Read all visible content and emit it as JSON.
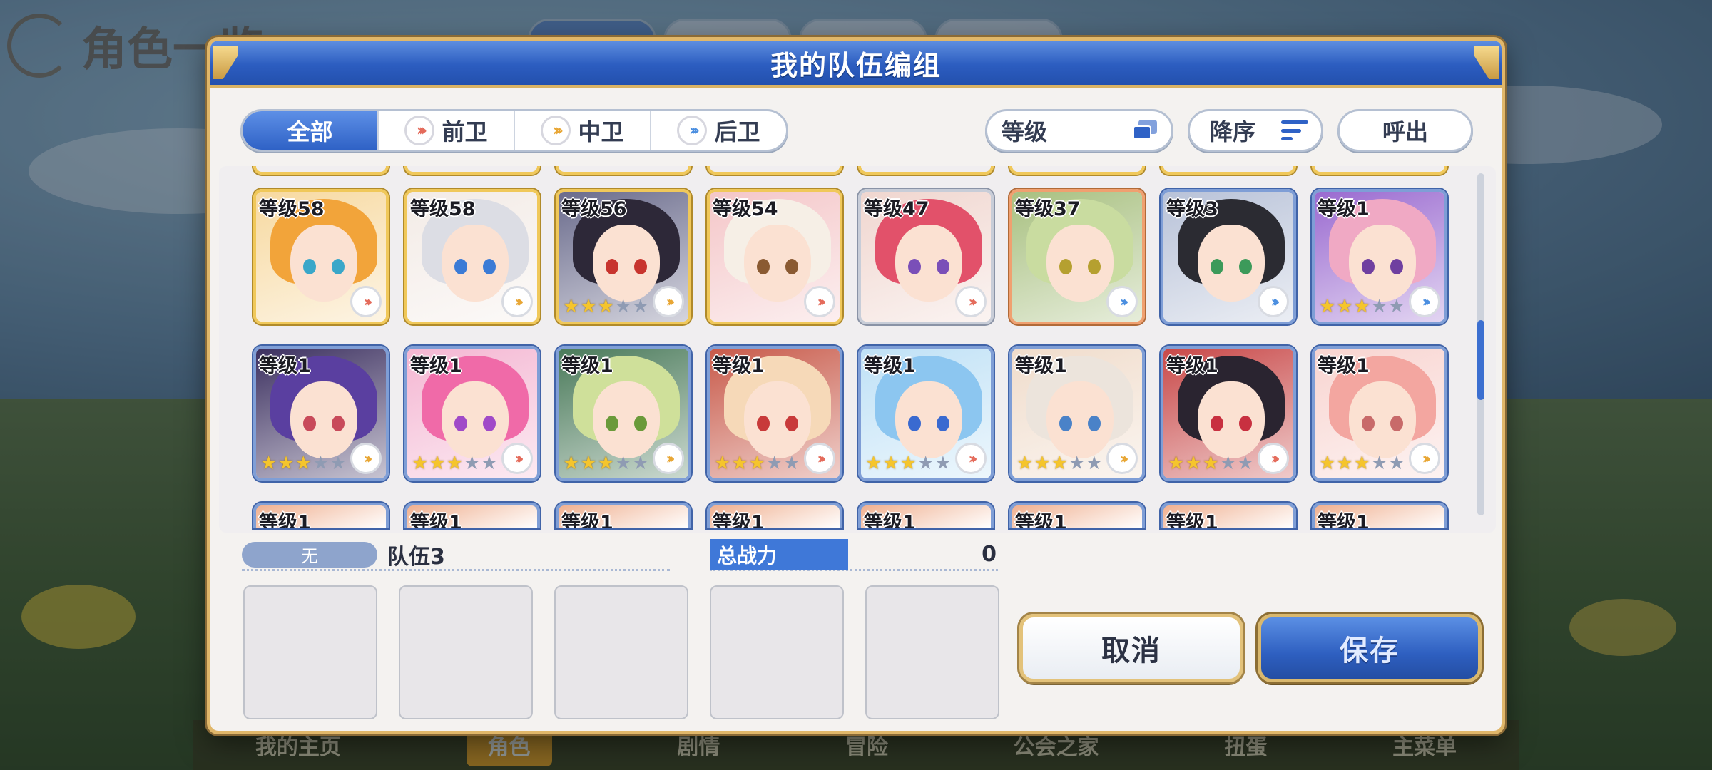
{
  "background": {
    "page_title": "角色一览",
    "nav": [
      "我的主页",
      "角色",
      "剧情",
      "冒险",
      "公会之家",
      "扭蛋",
      "主菜单"
    ]
  },
  "modal": {
    "title": "我的队伍编组",
    "filter_tabs": [
      {
        "label": "全部",
        "icon": "none",
        "active": true
      },
      {
        "label": "前卫",
        "icon": "front-role-icon",
        "active": false
      },
      {
        "label": "中卫",
        "icon": "mid-role-icon",
        "active": false
      },
      {
        "label": "后卫",
        "icon": "back-role-icon",
        "active": false
      }
    ],
    "sort_label": "等级",
    "order_label": "降序",
    "call_label": "呼出",
    "roster": {
      "row1": [
        {
          "level": "等级58",
          "frame": "gold",
          "stars": 0,
          "role": "front",
          "hair": "#f2a43a",
          "eye": "#3aa7c9",
          "bg": "#f7d9a0"
        },
        {
          "level": "等级58",
          "frame": "gold",
          "stars": 0,
          "role": "mid",
          "hair": "#dcdde4",
          "eye": "#3b7bd6",
          "bg": "#f3ebe6"
        },
        {
          "level": "等级56",
          "frame": "gold",
          "stars": 3,
          "role": "mid",
          "hair": "#2d2838",
          "eye": "#c8342e",
          "bg": "#6a6b8c"
        },
        {
          "level": "等级54",
          "frame": "gold",
          "stars": 0,
          "role": "front",
          "hair": "#f6efe6",
          "eye": "#8a5a32",
          "bg": "#f4c6c8"
        },
        {
          "level": "等级47",
          "frame": "silver",
          "stars": 0,
          "role": "front",
          "hair": "#e2516a",
          "eye": "#7a4fb8",
          "bg": "#f0d6cf"
        },
        {
          "level": "等级37",
          "frame": "copper",
          "stars": 0,
          "role": "back",
          "hair": "#c9dca0",
          "eye": "#b5a030",
          "bg": "#a8c080"
        },
        {
          "level": "等级3",
          "frame": "blue",
          "stars": 0,
          "role": "back",
          "hair": "#2b2b32",
          "eye": "#3c9a5a",
          "bg": "#b8c2d8"
        },
        {
          "level": "等级1",
          "frame": "blue",
          "stars": 3,
          "role": "back",
          "hair": "#f0a9c4",
          "eye": "#6f3fa0",
          "bg": "#9a6ad0"
        }
      ],
      "row2": [
        {
          "level": "等级1",
          "frame": "blue",
          "stars": 3,
          "role": "mid",
          "hair": "#5a3fa0",
          "eye": "#c84a5a",
          "bg": "#3c3060"
        },
        {
          "level": "等级1",
          "frame": "blue",
          "stars": 3,
          "role": "front",
          "hair": "#f06aa8",
          "eye": "#a04ac8",
          "bg": "#f4b6d2"
        },
        {
          "level": "等级1",
          "frame": "blue",
          "stars": 3,
          "role": "mid",
          "hair": "#cfe09a",
          "eye": "#6a9a3a",
          "bg": "#4a7a5a"
        },
        {
          "level": "等级1",
          "frame": "blue",
          "stars": 3,
          "role": "front",
          "hair": "#f6d9b8",
          "eye": "#c83a3a",
          "bg": "#c85a4a"
        },
        {
          "level": "等级1",
          "frame": "blue",
          "stars": 3,
          "role": "front",
          "hair": "#8cc6f0",
          "eye": "#3a6ad0",
          "bg": "#bfe1f6"
        },
        {
          "level": "等级1",
          "frame": "blue",
          "stars": 3,
          "role": "mid",
          "hair": "#ece4dc",
          "eye": "#4a82c8",
          "bg": "#f0dccb"
        },
        {
          "level": "等级1",
          "frame": "blue",
          "stars": 3,
          "role": "front",
          "hair": "#2a2430",
          "eye": "#c83040",
          "bg": "#c84848"
        },
        {
          "level": "等级1",
          "frame": "blue",
          "stars": 3,
          "role": "mid",
          "hair": "#f3a6a0",
          "eye": "#c86a6a",
          "bg": "#f8d4d0"
        }
      ],
      "row3": [
        "等级1",
        "等级1",
        "等级1",
        "等级1",
        "等级1",
        "等级1",
        "等级1",
        "等级1"
      ]
    },
    "team": {
      "tag": "无",
      "name": "队伍3",
      "power_label": "总战力",
      "power_value": "0"
    },
    "cancel_label": "取消",
    "save_label": "保存"
  }
}
